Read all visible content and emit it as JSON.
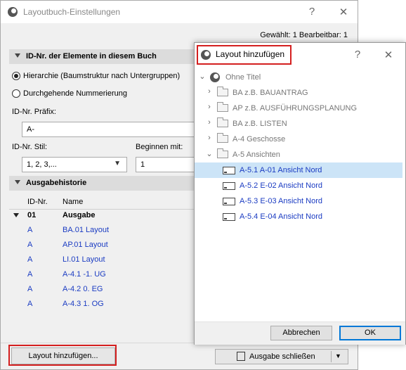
{
  "main_dialog": {
    "title": "Layoutbuch-Einstellungen",
    "help": "?",
    "close": "✕",
    "status": "Gewählt: 1 Bearbeitbar: 1",
    "id_section": {
      "title": "ID-Nr. der Elemente in diesem Buch",
      "radio_hierarchy": "Hierarchie (Baumstruktur nach Untergruppen)",
      "radio_continuous": "Durchgehende Nummerierung",
      "radio_selected": "hierarchy",
      "prefix_label": "ID-Nr. Präfix:",
      "prefix_value": "A-",
      "style_label": "ID-Nr. Stil:",
      "style_value": "1, 2, 3,...",
      "start_label": "Beginnen mit:",
      "start_value": "1"
    },
    "history_section": {
      "title": "Ausgabehistorie",
      "col_id": "ID-Nr.",
      "col_name": "Name",
      "group": {
        "id": "01",
        "name": "Ausgabe"
      },
      "rows": [
        {
          "id": "A",
          "name": "BA.01 Layout"
        },
        {
          "id": "A",
          "name": "AP.01 Layout"
        },
        {
          "id": "A",
          "name": "LI.01 Layout"
        },
        {
          "id": "A",
          "name": "A-4.1 -1. UG"
        },
        {
          "id": "A",
          "name": "A-4.2 0. EG"
        },
        {
          "id": "A",
          "name": "A-4.3 1. OG"
        }
      ]
    },
    "add_layout_button": "Layout hinzufügen...",
    "close_issue_button": "Ausgabe schließen"
  },
  "popup": {
    "title": "Layout hinzufügen",
    "help": "?",
    "close": "✕",
    "tree": [
      {
        "label": "Ohne Titel",
        "kind": "root",
        "expanded": true
      },
      {
        "label": "BA z.B. BAUANTRAG",
        "kind": "folder"
      },
      {
        "label": "AP z.B. AUSFÜHRUNGSPLANUNG",
        "kind": "folder"
      },
      {
        "label": "BA z.B. LISTEN",
        "kind": "folder"
      },
      {
        "label": "A-4 Geschosse",
        "kind": "folder"
      },
      {
        "label": "A-5 Ansichten",
        "kind": "folder",
        "expanded": true
      },
      {
        "label": "A-5.1 A-01 Ansicht Nord",
        "kind": "layout",
        "selected": true
      },
      {
        "label": "A-5.2 E-02 Ansicht Nord",
        "kind": "layout"
      },
      {
        "label": "A-5.3 E-03 Ansicht Nord",
        "kind": "layout"
      },
      {
        "label": "A-5.4 E-04 Ansicht Nord",
        "kind": "layout"
      }
    ],
    "cancel_button": "Abbrechen",
    "ok_button": "OK"
  },
  "colors": {
    "highlight_red": "#d41f1f",
    "link_blue": "#1a3bc2",
    "selection": "#cce4f7"
  }
}
